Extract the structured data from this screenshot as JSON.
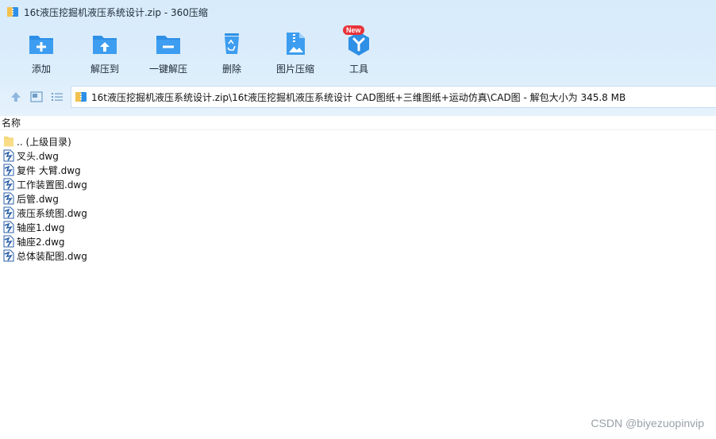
{
  "window": {
    "title": "16t液压挖掘机液压系统设计.zip - 360压缩"
  },
  "toolbar": {
    "add": "添加",
    "extract_to": "解压到",
    "one_click_extract": "一键解压",
    "delete": "删除",
    "image_compress": "图片压缩",
    "tools": "工具",
    "tools_badge": "New"
  },
  "navbar": {
    "path": "16t液压挖掘机液压系统设计.zip\\16t液压挖掘机液压系统设计 CAD图纸+三维图纸+运动仿真\\CAD图 - 解包大小为 345.8 MB"
  },
  "columns": {
    "name": "名称"
  },
  "files": {
    "parent": ".. (上级目录)",
    "items": [
      "叉头.dwg",
      "复件 大臂.dwg",
      "工作装置图.dwg",
      "后管.dwg",
      "液压系统图.dwg",
      "轴座1.dwg",
      "轴座2.dwg",
      "总体装配图.dwg"
    ]
  },
  "watermark": "CSDN @biyezuopinvip",
  "colors": {
    "accent_blue": "#2d8fe6",
    "chrome_bg": "#d7ebfb",
    "badge_red": "#e8323a",
    "folder_yellow": "#f5d576"
  }
}
